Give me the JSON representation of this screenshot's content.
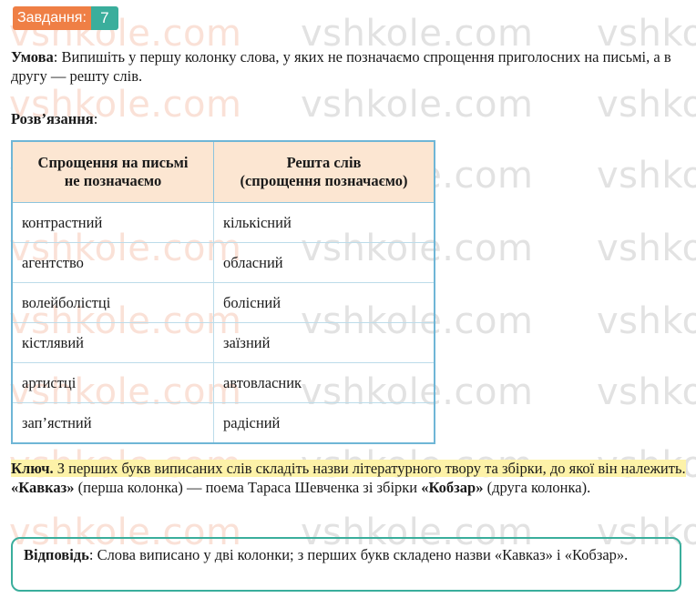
{
  "task": {
    "label": "Завдання:",
    "number": "7"
  },
  "condition": {
    "label": "Умова",
    "text": ": Випишіть у першу колонку слова, у яких не позначаємо спрощення приголосних на письмі, а в другу — решту слів."
  },
  "solution": {
    "label": "Розв’язання",
    "suffix": ":"
  },
  "table": {
    "headers": [
      {
        "line1": "Спрощення на письмі",
        "line2": "не позначаємо"
      },
      {
        "line1": "Решта слів",
        "line2": "(спрощення позначаємо)"
      }
    ],
    "rows": [
      [
        "контрастний",
        "кількісний"
      ],
      [
        "агентство",
        "обласний"
      ],
      [
        "волейболістці",
        "болісний"
      ],
      [
        "кістлявий",
        "заїзний"
      ],
      [
        "артистці",
        "автовласник"
      ],
      [
        "зап’ястний",
        "радісний"
      ]
    ]
  },
  "key": {
    "label": "Ключ.",
    "highlighted": " З перших букв виписаних слів складіть назви літературного твору та збірки, до якої він належить.",
    "work": "«Кавказ»",
    "middle": " (перша колонка) — поема Тараса Шевченка зі збірки ",
    "collection": "«Кобзар»",
    "end": " (друга колонка)."
  },
  "answer": {
    "label": "Відповідь",
    "text": ": Слова виписано у дві колонки; з перших букв складено назви «Кавказ» і «Кобзар»."
  },
  "watermark": "vshkole.com",
  "colors": {
    "badge_orange": "#ef7f45",
    "badge_teal": "#3aae9c",
    "table_border": "#6fb6d6",
    "header_bg": "#fce6d2",
    "highlight": "#fdf2a8"
  }
}
